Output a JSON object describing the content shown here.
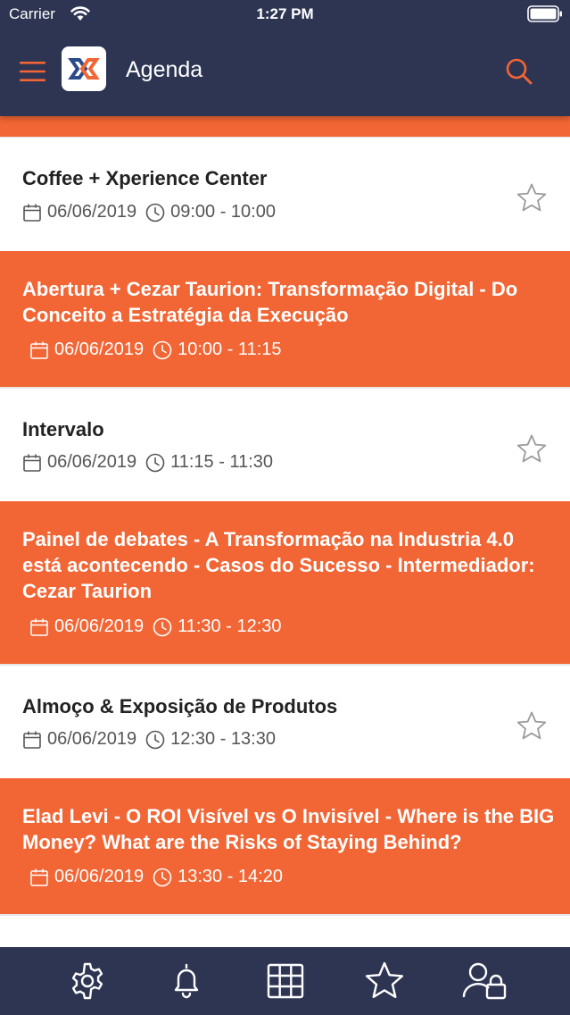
{
  "status": {
    "carrier": "Carrier",
    "time": "1:27 PM"
  },
  "header": {
    "title": "Agenda",
    "menu_icon": "hamburger-menu-icon",
    "search_icon": "search-icon",
    "logo": "app-logo"
  },
  "colors": {
    "nav_bg": "#2e3553",
    "accent": "#f26534",
    "white_card": "#ffffff"
  },
  "events": [
    {
      "title": "Coffee + Xperience Center",
      "date": "06/06/2019",
      "time": "09:00 - 10:00",
      "style": "white",
      "favorite": false
    },
    {
      "title": "Abertura + Cezar Taurion: Transformação Digital - Do Conceito a Estratégia da Execução",
      "date": "06/06/2019",
      "time": "10:00 - 11:15",
      "style": "orange"
    },
    {
      "title": "Intervalo",
      "date": "06/06/2019",
      "time": "11:15 - 11:30",
      "style": "white",
      "favorite": false
    },
    {
      "title": "Painel de debates - A Transformação na Industria 4.0 está acontecendo - Casos do Sucesso - Intermediador: Cezar Taurion",
      "date": "06/06/2019",
      "time": "11:30 - 12:30",
      "style": "orange"
    },
    {
      "title": "Almoço & Exposição de Produtos",
      "date": "06/06/2019",
      "time": "12:30 - 13:30",
      "style": "white",
      "favorite": false
    },
    {
      "title": "Elad Levi - O ROI Visível vs O Invisível - Where is the BIG Money? What are the Risks of Staying Behind?",
      "date": "06/06/2019",
      "time": "13:30 - 14:20",
      "style": "orange"
    }
  ],
  "tabbar": [
    {
      "icon": "gear-icon"
    },
    {
      "icon": "bell-icon"
    },
    {
      "icon": "grid-icon"
    },
    {
      "icon": "star-icon"
    },
    {
      "icon": "user-lock-icon"
    }
  ]
}
